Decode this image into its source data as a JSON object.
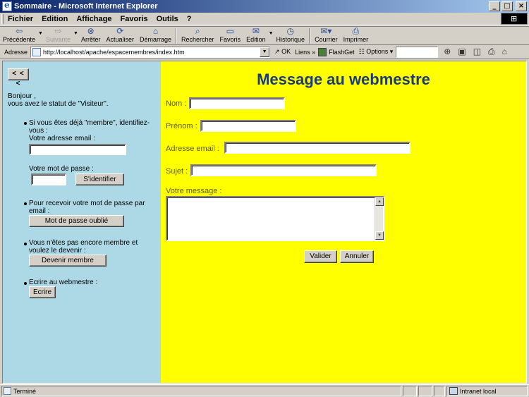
{
  "window": {
    "title": "Sommaire - Microsoft Internet Explorer"
  },
  "menu": [
    "Fichier",
    "Edition",
    "Affichage",
    "Favoris",
    "Outils",
    "?"
  ],
  "toolbar": {
    "back": "Précédente",
    "forward": "Suivante",
    "stop": "Arrêter",
    "refresh": "Actualiser",
    "home": "Démarrage",
    "search": "Rechercher",
    "favorites": "Favoris",
    "edit": "Edition",
    "history": "Historique",
    "mail": "Courrier",
    "print": "Imprimer"
  },
  "address": {
    "label": "Adresse",
    "url": "http://localhost/apache/espacemembres/index.htm",
    "go": "OK",
    "links": "Liens",
    "flashget": "FlashGet",
    "options": "Options"
  },
  "left": {
    "back_button": "< < <",
    "greeting_line1": "Bonjour ,",
    "greeting_line2": "vous avez le statut de \"Visiteur\".",
    "member_text_line1": "Si vous êtes déjà \"membre\", identifiez-",
    "member_text_line2": "vous :",
    "email_label": "Votre adresse email :",
    "email_value": "",
    "password_label": "Votre mot de passe :",
    "password_value": "",
    "login_button": "S'identifier",
    "forgot_text_line1": "Pour recevoir votre mot de passe par",
    "forgot_text_line2": "email :",
    "forgot_button": "Mot de passe oublié",
    "join_text_line1": "Vous n'êtes pas encore membre et",
    "join_text_line2": "voulez le devenir :",
    "join_button": "Devenir membre",
    "write_text": "Ecrire au webmestre :",
    "write_button": "Ecrire"
  },
  "form": {
    "title": "Message au webmestre",
    "name_label": "Nom :",
    "name_value": "",
    "firstname_label": "Prénom :",
    "firstname_value": "",
    "email_label": "Adresse email :",
    "email_value": "",
    "subject_label": "Sujet :",
    "subject_value": "",
    "message_label": "Votre message :",
    "message_value": "",
    "submit": "Valider",
    "cancel": "Annuler"
  },
  "status": {
    "text": "Terminé",
    "zone": "Intranet local"
  },
  "colors": {
    "left_frame": "#add8e6",
    "right_frame": "#ffff00",
    "title_text": "#1a3a7a"
  }
}
